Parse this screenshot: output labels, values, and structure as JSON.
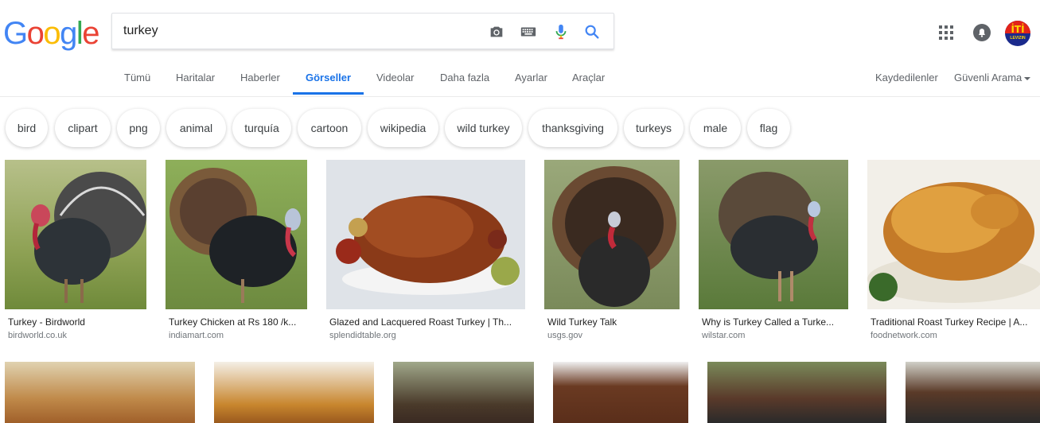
{
  "logo": {
    "letters": [
      "G",
      "o",
      "o",
      "g",
      "l",
      "e"
    ],
    "colors": [
      "#4285F4",
      "#EA4335",
      "#FBBC05",
      "#4285F4",
      "#34A853",
      "#EA4335"
    ]
  },
  "search": {
    "value": "turkey"
  },
  "tabs": [
    {
      "label": "Tümü"
    },
    {
      "label": "Haritalar"
    },
    {
      "label": "Haberler"
    },
    {
      "label": "Görseller"
    },
    {
      "label": "Videolar"
    },
    {
      "label": "Daha fazla"
    },
    {
      "label": "Ayarlar"
    },
    {
      "label": "Araçlar"
    }
  ],
  "right_links": {
    "saved": "Kaydedilenler",
    "safe_search": "Güvenli Arama"
  },
  "avatar": {
    "text": "İTİ",
    "subtext": "LEVIZIN"
  },
  "chips": [
    "bird",
    "clipart",
    "png",
    "animal",
    "turquía",
    "cartoon",
    "wikipedia",
    "wild turkey",
    "thanksgiving",
    "turkeys",
    "male",
    "flag"
  ],
  "results": [
    {
      "title": "Turkey - Birdworld",
      "source": "birdworld.co.uk",
      "bg": "#7a8c4a"
    },
    {
      "title": "Turkey Chicken at Rs 180 /k...",
      "source": "indiamart.com",
      "bg": "#6d8a3f"
    },
    {
      "title": "Glazed and Lacquered Roast Turkey | Th...",
      "source": "splendidtable.org",
      "bg": "#d9dde2"
    },
    {
      "title": "Wild Turkey Talk",
      "source": "usgs.gov",
      "bg": "#8b9a6a"
    },
    {
      "title": "Why is Turkey Called a Turke...",
      "source": "wilstar.com",
      "bg": "#6f8a4a"
    },
    {
      "title": "Traditional Roast Turkey Recipe | A...",
      "source": "foodnetwork.com",
      "bg": "#c89550"
    }
  ],
  "accent": "#1a73e8"
}
